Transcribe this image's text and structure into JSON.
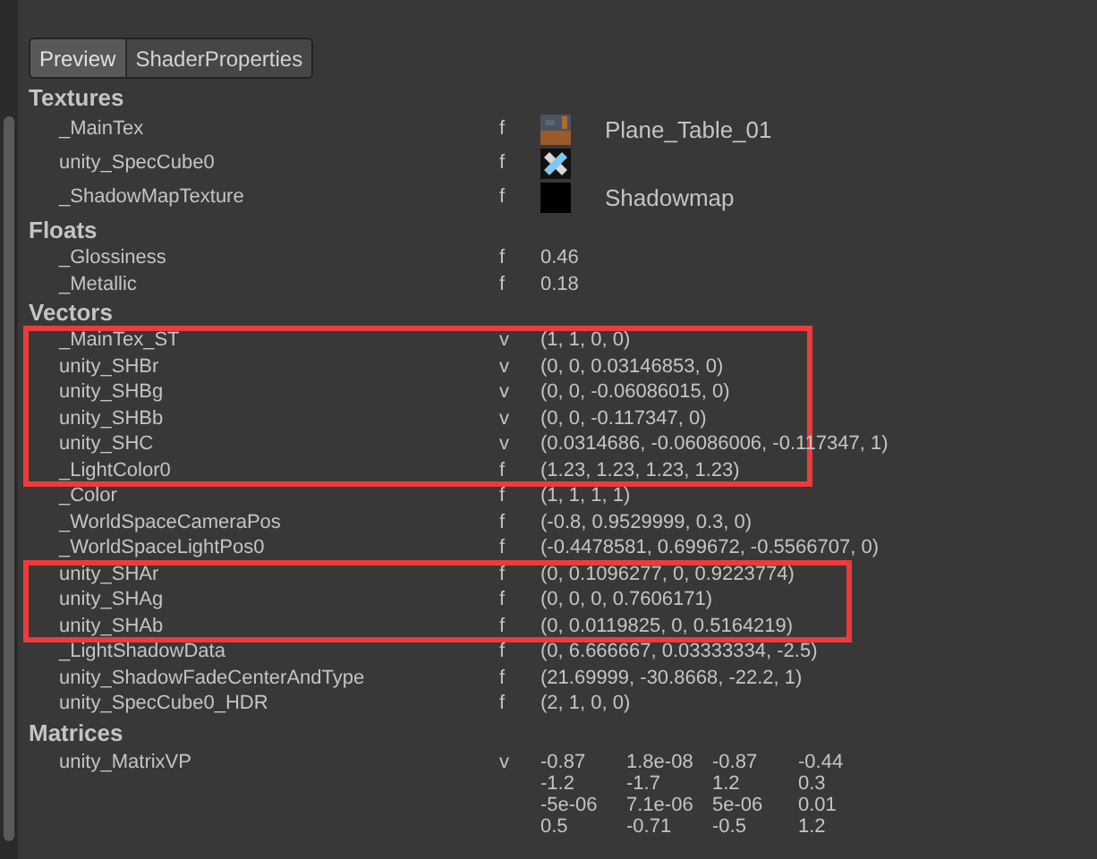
{
  "tabs": [
    {
      "label": "Preview",
      "selected": true
    },
    {
      "label": "ShaderProperties",
      "selected": false
    }
  ],
  "sections": [
    {
      "title": "Textures",
      "items": [
        {
          "kind": "texture",
          "name": "_MainTex",
          "type": "f",
          "texture": "Plane_Table_01"
        },
        {
          "kind": "texture",
          "name": "unity_SpecCube0",
          "type": "f"
        },
        {
          "kind": "texture",
          "name": "_ShadowMapTexture",
          "type": "f",
          "texture": "Shadowmap"
        }
      ]
    },
    {
      "title": "Floats",
      "items": [
        {
          "kind": "value",
          "name": "_Glossiness",
          "type": "f",
          "value": "0.46"
        },
        {
          "kind": "value",
          "name": "_Metallic",
          "type": "f",
          "value": "0.18"
        }
      ]
    },
    {
      "title": "Vectors",
      "items": [
        {
          "kind": "highlight",
          "items": [
            {
              "kind": "value",
              "name": "_MainTex_ST",
              "type": "v",
              "value": "(1, 1, 0, 0)"
            },
            {
              "kind": "value",
              "name": "unity_SHBr",
              "type": "v",
              "value": "(0, 0, 0.03146853, 0)"
            },
            {
              "kind": "value",
              "name": "unity_SHBg",
              "type": "v",
              "value": "(0, 0, -0.06086015, 0)"
            },
            {
              "kind": "value",
              "name": "unity_SHBb",
              "type": "v",
              "value": "(0, 0, -0.117347, 0)"
            },
            {
              "kind": "value",
              "name": "unity_SHC",
              "type": "v",
              "value": "(0.0314686, -0.06086006, -0.117347, 1)"
            },
            {
              "kind": "value",
              "name": "_LightColor0",
              "type": "f",
              "value": "(1.23, 1.23, 1.23, 1.23)"
            }
          ]
        },
        {
          "kind": "value",
          "name": "_Color",
          "type": "f",
          "value": "(1, 1, 1, 1)"
        },
        {
          "kind": "value",
          "name": "_WorldSpaceCameraPos",
          "type": "f",
          "value": "(-0.8, 0.9529999, 0.3, 0)"
        },
        {
          "kind": "value",
          "name": "_WorldSpaceLightPos0",
          "type": "f",
          "value": "(-0.4478581, 0.699672, -0.5566707, 0)"
        },
        {
          "kind": "highlight",
          "items": [
            {
              "kind": "value",
              "name": "unity_SHAr",
              "type": "f",
              "value": "(0, 0.1096277, 0, 0.9223774)"
            },
            {
              "kind": "value",
              "name": "unity_SHAg",
              "type": "f",
              "value": "(0, 0, 0, 0.7606171)"
            },
            {
              "kind": "value",
              "name": "unity_SHAb",
              "type": "f",
              "value": "(0, 0.0119825, 0, 0.5164219)"
            }
          ]
        },
        {
          "kind": "value",
          "name": "_LightShadowData",
          "type": "f",
          "value": "(0, 6.666667, 0.03333334, -2.5)"
        },
        {
          "kind": "value",
          "name": "unity_ShadowFadeCenterAndType",
          "type": "f",
          "value": "(21.69999, -30.8668, -22.2, 1)"
        },
        {
          "kind": "value",
          "name": "unity_SpecCube0_HDR",
          "type": "f",
          "value": "(2, 1, 0, 0)"
        }
      ]
    },
    {
      "title": "Matrices",
      "items": [
        {
          "kind": "matrix",
          "name": "unity_MatrixVP",
          "type": "v",
          "rows": [
            [
              "-0.87",
              "1.8e-08",
              "-0.87",
              "-0.44"
            ],
            [
              "-1.2",
              "-1.7",
              "1.2",
              "0.3"
            ],
            [
              "-5e-06",
              "7.1e-06",
              "5e-06",
              "0.01"
            ],
            [
              "0.5",
              "-0.71",
              "-0.5",
              "1.2"
            ]
          ]
        }
      ]
    }
  ]
}
